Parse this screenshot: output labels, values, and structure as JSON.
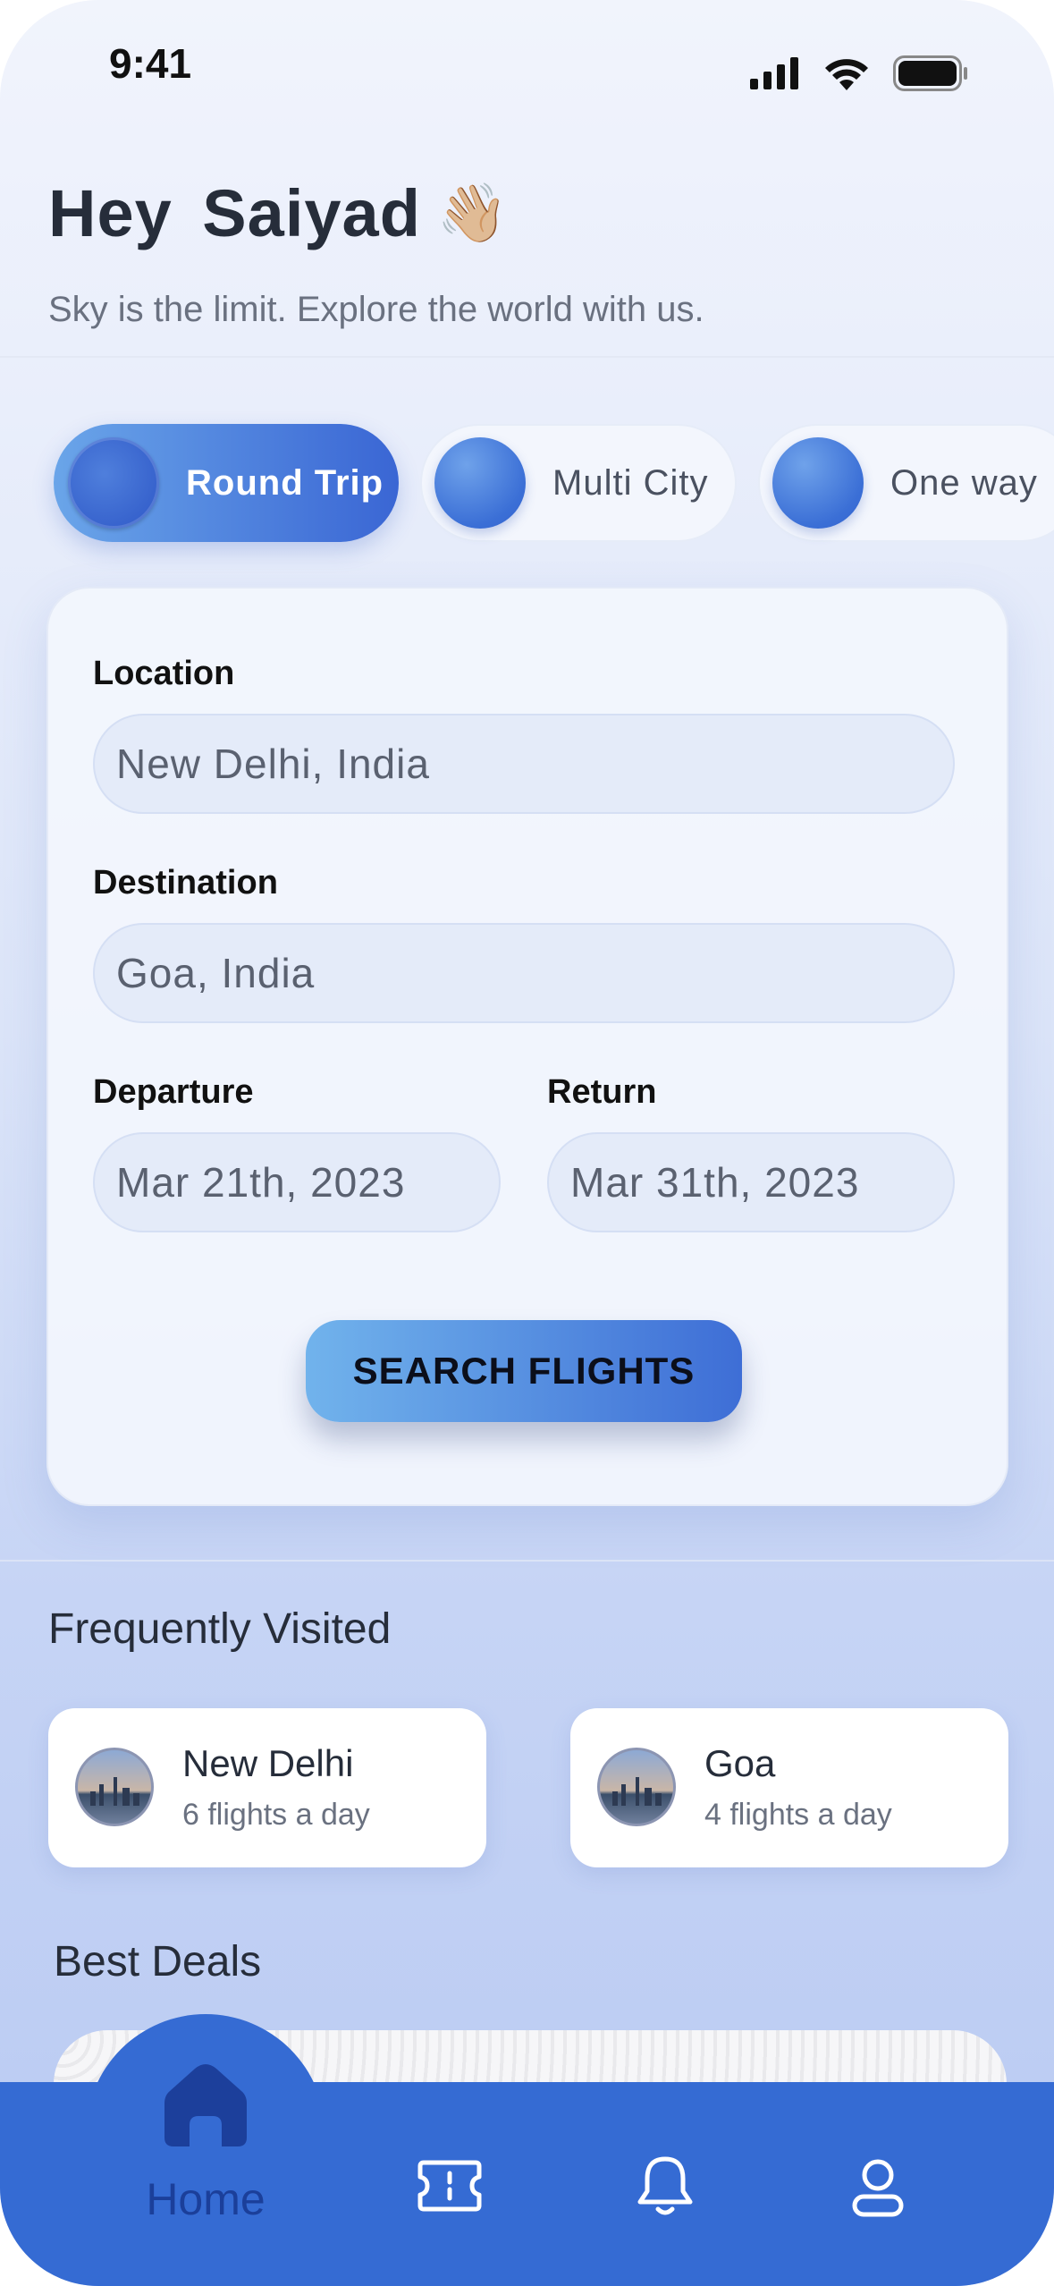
{
  "status_bar": {
    "time": "9:41"
  },
  "header": {
    "greeting": "Hey Saiyad",
    "wave_emoji": "👋🏼",
    "subtitle": "Sky is the limit. Explore the world with us."
  },
  "trip_types": [
    {
      "label": "Round Trip",
      "selected": true
    },
    {
      "label": "Multi City",
      "selected": false
    },
    {
      "label": "One way",
      "selected": false
    }
  ],
  "search_form": {
    "location": {
      "label": "Location",
      "value": "New Delhi, India"
    },
    "destination": {
      "label": "Destination",
      "value": "Goa, India"
    },
    "departure": {
      "label": "Departure",
      "value": "Mar 21th, 2023"
    },
    "return": {
      "label": "Return",
      "value": "Mar 31th, 2023"
    },
    "search_button": "SEARCH FLIGHTS"
  },
  "frequently_visited": {
    "title": "Frequently Visited",
    "items": [
      {
        "city": "New Delhi",
        "subtitle": "6 flights a day"
      },
      {
        "city": "Goa",
        "subtitle": "4 flights a day"
      }
    ]
  },
  "best_deals": {
    "title": "Best Deals"
  },
  "bottom_nav": {
    "items": [
      {
        "label": "Home",
        "icon": "home-icon",
        "active": true
      },
      {
        "label": "",
        "icon": "ticket-icon",
        "active": false
      },
      {
        "label": "",
        "icon": "bell-icon",
        "active": false
      },
      {
        "label": "",
        "icon": "profile-icon",
        "active": false
      }
    ],
    "accent": "#356bd3"
  },
  "colors": {
    "primary": "#3a66d4",
    "primary_light": "#6aa5e9",
    "text_dark": "#262d3a",
    "text_muted": "#6a7180"
  }
}
